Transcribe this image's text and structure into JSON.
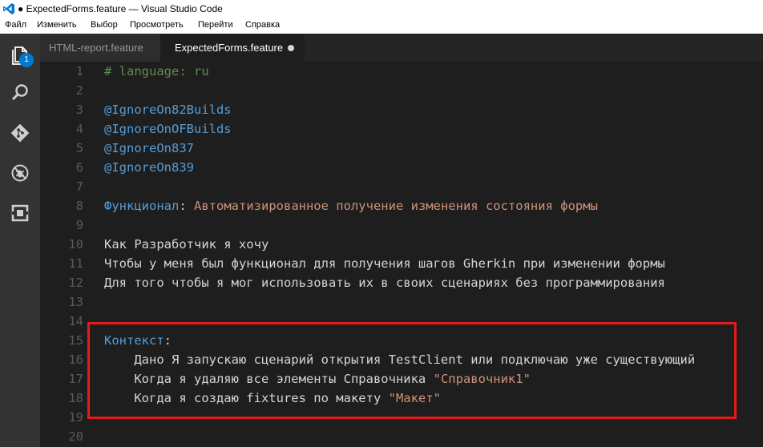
{
  "window": {
    "title": "● ExpectedForms.feature — Visual Studio Code"
  },
  "menu": [
    "Файл",
    "Изменить",
    "Выбор",
    "Просмотреть",
    "Перейти",
    "Справка"
  ],
  "activity_bar": {
    "icons": [
      "files-icon",
      "search-icon",
      "git-icon",
      "debug-icon",
      "extensions-icon"
    ],
    "badge": "1"
  },
  "tabs": [
    {
      "label": "HTML-report.feature",
      "active": false
    },
    {
      "label": "ExpectedForms.feature",
      "active": true,
      "modified": true
    }
  ],
  "editor": {
    "lines": [
      {
        "n": "1",
        "parts": [
          {
            "t": "# language: ru",
            "c": "comment"
          }
        ]
      },
      {
        "n": "2",
        "parts": []
      },
      {
        "n": "3",
        "parts": [
          {
            "t": "@IgnoreOn82Builds",
            "c": "tag"
          }
        ]
      },
      {
        "n": "4",
        "parts": [
          {
            "t": "@IgnoreOnOFBuilds",
            "c": "tag"
          }
        ]
      },
      {
        "n": "5",
        "parts": [
          {
            "t": "@IgnoreOn837",
            "c": "tag"
          }
        ]
      },
      {
        "n": "6",
        "parts": [
          {
            "t": "@IgnoreOn839",
            "c": "tag"
          }
        ]
      },
      {
        "n": "7",
        "parts": []
      },
      {
        "n": "8",
        "parts": [
          {
            "t": "Функционал",
            "c": "kw"
          },
          {
            "t": ": ",
            "c": "plain"
          },
          {
            "t": "Автоматизированное получение изменения состояния формы",
            "c": "str"
          }
        ]
      },
      {
        "n": "9",
        "parts": []
      },
      {
        "n": "10",
        "parts": [
          {
            "t": "Как Разработчик я хочу",
            "c": "plain"
          }
        ]
      },
      {
        "n": "11",
        "parts": [
          {
            "t": "Чтобы у меня был функционал для получения шагов Gherkin при изменении формы",
            "c": "plain"
          }
        ]
      },
      {
        "n": "12",
        "parts": [
          {
            "t": "Для того чтобы я мог использовать их в своих сценариях без программирования",
            "c": "plain"
          }
        ]
      },
      {
        "n": "13",
        "parts": []
      },
      {
        "n": "14",
        "parts": []
      },
      {
        "n": "15",
        "parts": [
          {
            "t": "Контекст",
            "c": "kw"
          },
          {
            "t": ":",
            "c": "plain"
          }
        ]
      },
      {
        "n": "16",
        "parts": [
          {
            "t": "    Дано Я запускаю сценарий открытия TestClient или подключаю уже существующий",
            "c": "plain"
          }
        ]
      },
      {
        "n": "17",
        "parts": [
          {
            "t": "    Когда я удаляю все элементы Справочника ",
            "c": "plain"
          },
          {
            "t": "\"Справочник1\"",
            "c": "str"
          }
        ]
      },
      {
        "n": "18",
        "parts": [
          {
            "t": "    Когда я создаю fixtures по макету ",
            "c": "plain"
          },
          {
            "t": "\"Макет\"",
            "c": "str"
          }
        ]
      },
      {
        "n": "19",
        "parts": []
      },
      {
        "n": "20",
        "parts": []
      }
    ]
  },
  "colors": {
    "comment": "#608b4e",
    "keyword": "#569cd6",
    "string": "#ce9178",
    "text": "#d4d4d4",
    "highlight_border": "#e31b1b",
    "accent": "#007acc"
  }
}
